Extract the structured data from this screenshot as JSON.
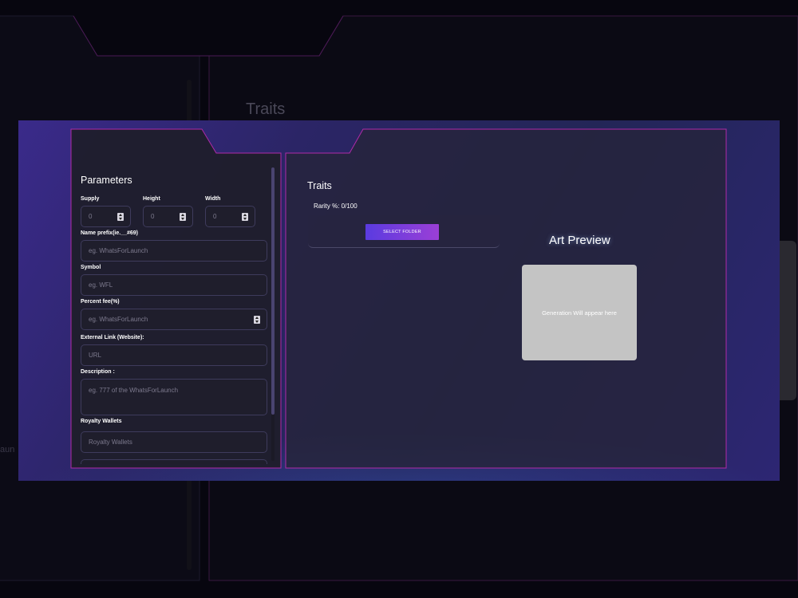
{
  "background": {
    "traits_heading": "Traits",
    "side_text": "aun"
  },
  "parameters": {
    "title": "Parameters",
    "supply": {
      "label": "Supply",
      "value": "0"
    },
    "height": {
      "label": "Height",
      "value": "0"
    },
    "width": {
      "label": "Width",
      "value": "0"
    },
    "name_prefix": {
      "label": "Name prefix(ie.__#69)",
      "placeholder": "eg. WhatsForLaunch"
    },
    "symbol": {
      "label": "Symbol",
      "placeholder": "eg. WFL"
    },
    "percent_fee": {
      "label": "Percent fee(%)",
      "placeholder": "eg. WhatsForLaunch"
    },
    "external_link": {
      "label": "External Link (Website):",
      "placeholder": "URL"
    },
    "description": {
      "label": "Description :",
      "placeholder": "eg. 777 of the WhatsForLaunch"
    },
    "royalty_wallets": {
      "label": "Royalty Wallets",
      "placeholder": "Royalty Wallets"
    }
  },
  "traits": {
    "title": "Traits",
    "rarity": "Rarity %: 0/100",
    "select_folder_label": "SELECT FOLDER"
  },
  "art_preview": {
    "title": "Art Preview",
    "placeholder": "Generation Will appear here"
  },
  "colors": {
    "accent_magenta": "#b02aa8",
    "button_start": "#5a3be0",
    "button_end": "#9b3fd6",
    "preview_box": "#c4c4c4"
  }
}
